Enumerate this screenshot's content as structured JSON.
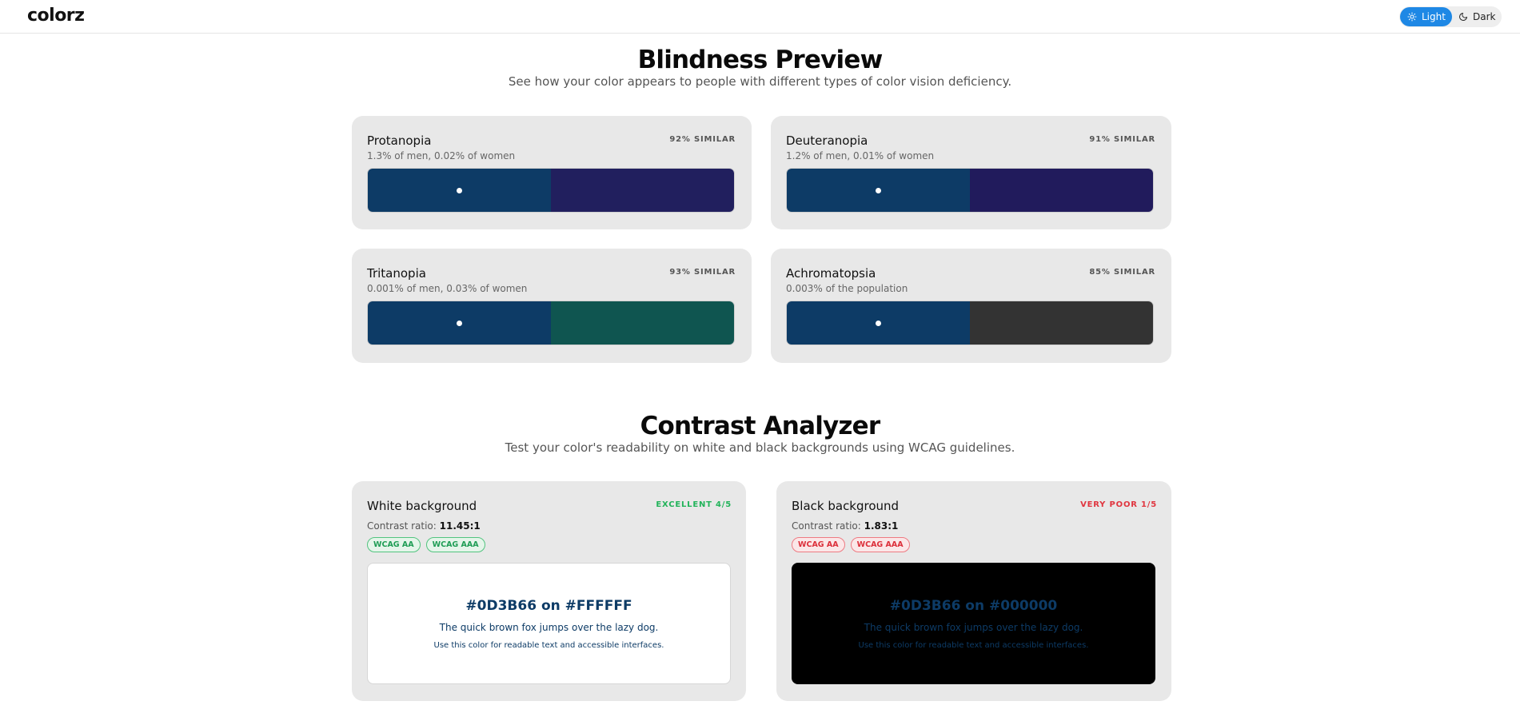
{
  "header": {
    "logo": "colorz",
    "theme": {
      "light_label": "Light",
      "dark_label": "Dark",
      "active": "light",
      "accent": "#1E88E5"
    }
  },
  "blindness": {
    "title": "Blindness Preview",
    "subtitle": "See how your color appears to people with different types of color vision deficiency.",
    "cards": [
      {
        "name": "Protanopia",
        "meta": "1.3% of men, 0.02% of women",
        "similarity": "92% SIMILAR",
        "original": "#0D3B66",
        "simulated": "#211F5E"
      },
      {
        "name": "Deuteranopia",
        "meta": "1.2% of men, 0.01% of women",
        "similarity": "91% SIMILAR",
        "original": "#0D3B66",
        "simulated": "#211B5C"
      },
      {
        "name": "Tritanopia",
        "meta": "0.001% of men, 0.03% of women",
        "similarity": "93% SIMILAR",
        "original": "#0D3B66",
        "simulated": "#0F5550"
      },
      {
        "name": "Achromatopsia",
        "meta": "0.003% of the population",
        "similarity": "85% SIMILAR",
        "original": "#0D3B66",
        "simulated": "#333333"
      }
    ]
  },
  "contrast": {
    "title": "Contrast Analyzer",
    "subtitle": "Test your color's readability on white and black backgrounds using WCAG guidelines.",
    "cards": [
      {
        "name": "White background",
        "rating": "EXCELLENT 4/5",
        "rating_color": "#22B35A",
        "ratio_label": "Contrast ratio:",
        "ratio_value": "11.45:1",
        "badges": [
          "WCAG AA",
          "WCAG AAA"
        ],
        "badge_state": "pass",
        "background": "#FFFFFF",
        "preview_title": "#0D3B66 on #FFFFFF",
        "preview_text": "The quick brown fox jumps over the lazy dog.",
        "preview_small": "Use this color for readable text and accessible interfaces."
      },
      {
        "name": "Black background",
        "rating": "VERY POOR 1/5",
        "rating_color": "#E0353F",
        "ratio_label": "Contrast ratio:",
        "ratio_value": "1.83:1",
        "badges": [
          "WCAG AA",
          "WCAG AAA"
        ],
        "badge_state": "fail",
        "background": "#000000",
        "preview_title": "#0D3B66 on #000000",
        "preview_text": "The quick brown fox jumps over the lazy dog.",
        "preview_small": "Use this color for readable text and accessible interfaces."
      }
    ]
  }
}
